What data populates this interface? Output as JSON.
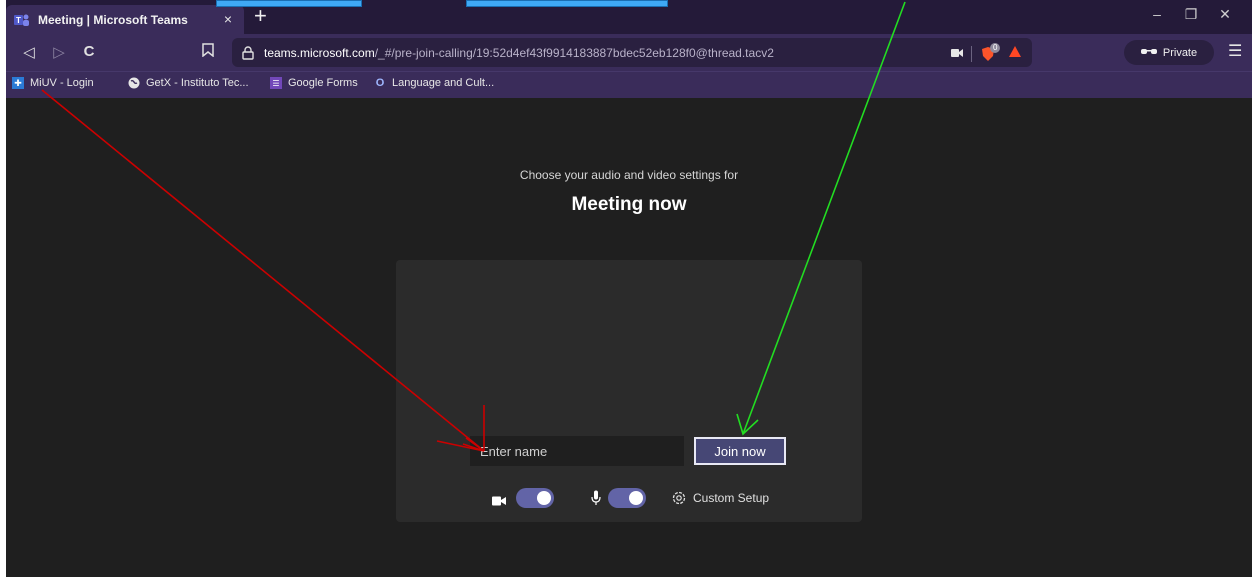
{
  "browser": {
    "tab_title": "Meeting | Microsoft Teams",
    "tab_close": "×",
    "new_tab": "+",
    "url_host": "teams.microsoft.com",
    "url_path": "/_#/pre-join-calling/19:52d4ef43f9914183887bdec52eb128f0@thread.tacv2",
    "private_label": "Private",
    "shield_badge": "0",
    "window": {
      "minimize": "–",
      "restore": "❐",
      "close": "✕"
    },
    "nav": {
      "back": "◁",
      "forward": "▷",
      "reload": "C",
      "menu": "☰"
    }
  },
  "bookmarks": [
    {
      "label": "MiUV - Login",
      "icon": "miuv-icon"
    },
    {
      "label": "GetX - Instituto Tec...",
      "icon": "globe-icon"
    },
    {
      "label": "Google Forms",
      "icon": "forms-icon"
    },
    {
      "label": "Language and Cult...",
      "icon": "language-icon"
    }
  ],
  "prejoin": {
    "subtitle": "Choose your audio and video settings for",
    "meeting_title": "Meeting now",
    "name_placeholder": "Enter name",
    "join_label": "Join now",
    "camera_on": true,
    "mic_on": true,
    "custom_setup_label": "Custom Setup"
  },
  "colors": {
    "chrome_dark": "#241a39",
    "chrome": "#3a2c5a",
    "teams_purple": "#6264a7",
    "join_button": "#464775",
    "annotation_red": "#cc0000",
    "annotation_green": "#22dd22"
  }
}
